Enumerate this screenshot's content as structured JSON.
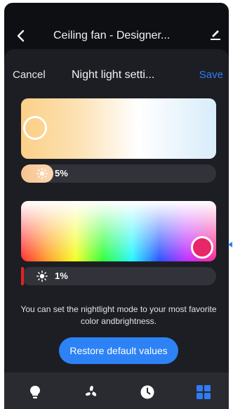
{
  "topbar": {
    "title": "Ceiling fan - Designer...",
    "back_icon": "chevron-left-icon",
    "edit_icon": "edit-pencil-icon"
  },
  "sheet": {
    "cancel_label": "Cancel",
    "title": "Night light setti...",
    "save_label": "Save"
  },
  "white_light": {
    "brightness_label": "5%",
    "brightness_percent": 5,
    "sun_icon": "sun-icon"
  },
  "color_light": {
    "brightness_label": "1%",
    "brightness_percent": 1,
    "sun_icon": "sun-icon"
  },
  "info_text": "You can set the nightlight mode to your most favorite color andbrightness.",
  "restore_label": "Restore default values",
  "bottom_nav": {
    "items": [
      {
        "icon": "light-bulb-icon",
        "active": false
      },
      {
        "icon": "fan-icon",
        "active": false
      },
      {
        "icon": "clock-icon",
        "active": false
      },
      {
        "icon": "grid-apps-icon",
        "active": true
      }
    ]
  },
  "colors": {
    "accent": "#2f7cf6",
    "background": "#0e0f13",
    "sheet": "#1d1e24",
    "nav": "#2a2b31",
    "selected_color": "#e8266a"
  }
}
